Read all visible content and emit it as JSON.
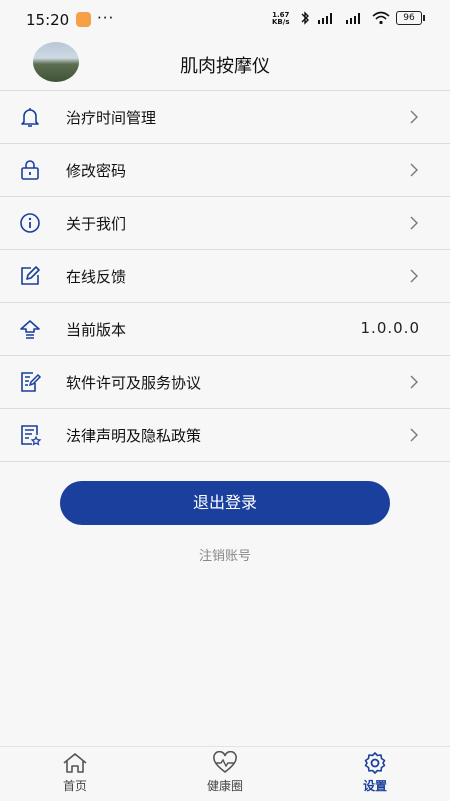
{
  "status_bar": {
    "time": "15:20",
    "dots": "···",
    "speed_value": "1.67",
    "speed_unit": "KB/s",
    "battery": "96"
  },
  "header": {
    "title": "肌肉按摩仪"
  },
  "menu": {
    "items": [
      {
        "label": "治疗时间管理",
        "icon": "bell-icon"
      },
      {
        "label": "修改密码",
        "icon": "lock-icon"
      },
      {
        "label": "关于我们",
        "icon": "info-icon"
      },
      {
        "label": "在线反馈",
        "icon": "edit-icon"
      },
      {
        "label": "当前版本",
        "icon": "upload-icon",
        "value": "1.0.0.0"
      },
      {
        "label": "软件许可及服务协议",
        "icon": "document-edit-icon"
      },
      {
        "label": "法律声明及隐私政策",
        "icon": "document-star-icon"
      }
    ]
  },
  "actions": {
    "logout_label": "退出登录",
    "cancel_account_label": "注销账号"
  },
  "tabbar": {
    "tabs": [
      {
        "label": "首页",
        "icon": "home-icon"
      },
      {
        "label": "健康圈",
        "icon": "heart-pulse-icon"
      },
      {
        "label": "设置",
        "icon": "gear-icon",
        "active": true
      }
    ]
  },
  "colors": {
    "accent": "#1b3f9c",
    "background": "#f7f7f7",
    "divider": "#dcdcdc"
  }
}
